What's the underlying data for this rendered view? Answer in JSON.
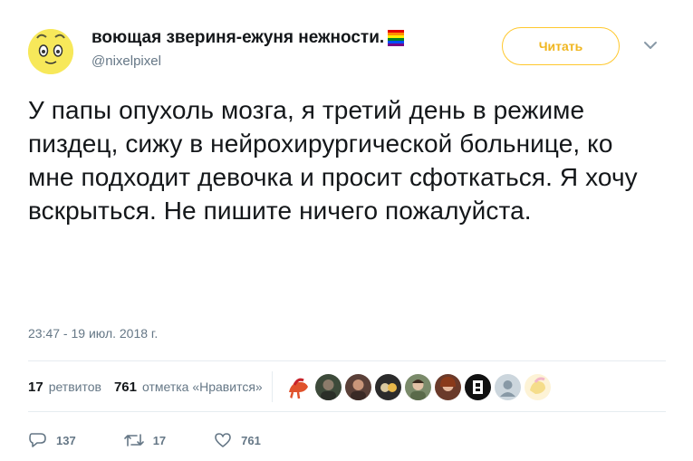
{
  "user": {
    "display_name": "воющая звериня-ежуня нежности.",
    "handle": "@nixelpixel",
    "avatar_color": "#f7e85a"
  },
  "follow_button": {
    "label": "Читать",
    "color": "#ffc82e"
  },
  "tweet": {
    "text": "У папы опухоль мозга, я третий день в режиме пиздец, сижу в нейрохирургической больнице, ко мне подходит девочка и просит сфоткаться. Я хочу вскрыться. Не пишите ничего пожалуйста.",
    "timestamp": "23:47 - 19 июл. 2018 г."
  },
  "stats": {
    "retweets_count": "17",
    "retweets_label": "ретвитов",
    "likes_count": "761",
    "likes_label": "отметка «Нравится»"
  },
  "likers": [
    "pony-avatar",
    "avatar-2",
    "avatar-3",
    "avatar-4",
    "avatar-5",
    "avatar-6",
    "avatar-7",
    "default-avatar",
    "avatar-9"
  ],
  "actions": {
    "reply_count": "137",
    "retweet_count": "17",
    "like_count": "761"
  },
  "colors": {
    "text": "#14171a",
    "muted": "#657786",
    "follow_accent": "#ffc82e",
    "divider": "#e6ecf0"
  }
}
